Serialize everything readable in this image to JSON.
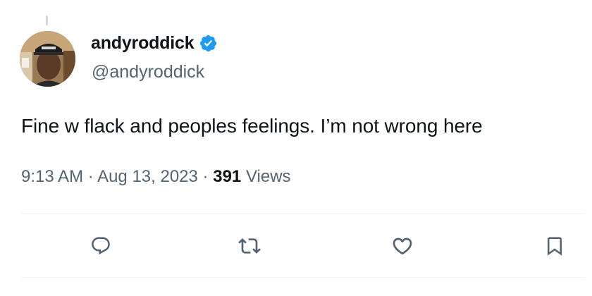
{
  "tweet": {
    "display_name": "andyroddick",
    "handle": "@andyroddick",
    "verified": true,
    "text": "Fine w flack and peoples feelings. I’m not wrong here",
    "time": "9:13 AM",
    "separator": "·",
    "date": "Aug 13, 2023",
    "views_count": "391",
    "views_label": "Views"
  },
  "icons": {
    "reply": "reply-icon",
    "retweet": "retweet-icon",
    "like": "like-icon",
    "bookmark": "bookmark-icon",
    "verified": "verified-badge-icon"
  },
  "colors": {
    "text_primary": "#0f1419",
    "text_secondary": "#536471",
    "verified_blue": "#1d9bf0",
    "divider": "#eff3f4"
  }
}
